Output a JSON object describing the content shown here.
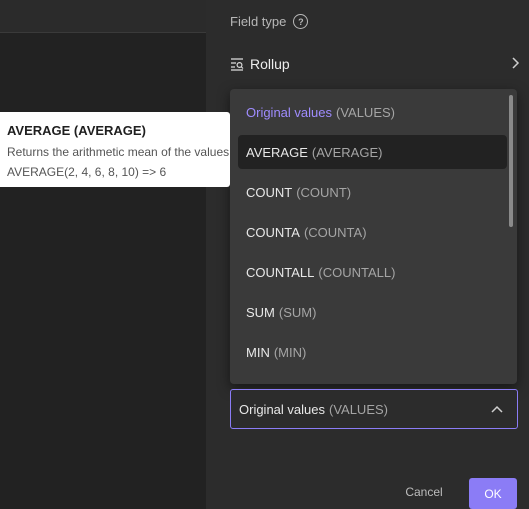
{
  "panel": {
    "field_type_label": "Field type",
    "help_glyph": "?",
    "rollup_label": "Rollup"
  },
  "dropdown": {
    "options": [
      {
        "name": "Original values",
        "code": "(VALUES)"
      },
      {
        "name": "AVERAGE",
        "code": "(AVERAGE)"
      },
      {
        "name": "COUNT",
        "code": "(COUNT)"
      },
      {
        "name": "COUNTA",
        "code": "(COUNTA)"
      },
      {
        "name": "COUNTALL",
        "code": "(COUNTALL)"
      },
      {
        "name": "SUM",
        "code": "(SUM)"
      },
      {
        "name": "MIN",
        "code": "(MIN)"
      }
    ]
  },
  "select": {
    "value_name": "Original values",
    "value_code": "(VALUES)"
  },
  "buttons": {
    "cancel": "Cancel",
    "ok": "OK"
  },
  "tooltip": {
    "title": "AVERAGE (AVERAGE)",
    "description": "Returns the arithmetic mean of the values",
    "example": "AVERAGE(2, 4, 6, 8, 10) => 6"
  },
  "colors": {
    "accent": "#8b7cf6",
    "selected_text": "#9f8cff",
    "panel_bg": "#2c2c2c",
    "dropdown_bg": "#3a3a3a"
  },
  "icons": [
    "help-icon",
    "rollup-icon",
    "chevron-right-icon",
    "chevron-up-icon"
  ]
}
